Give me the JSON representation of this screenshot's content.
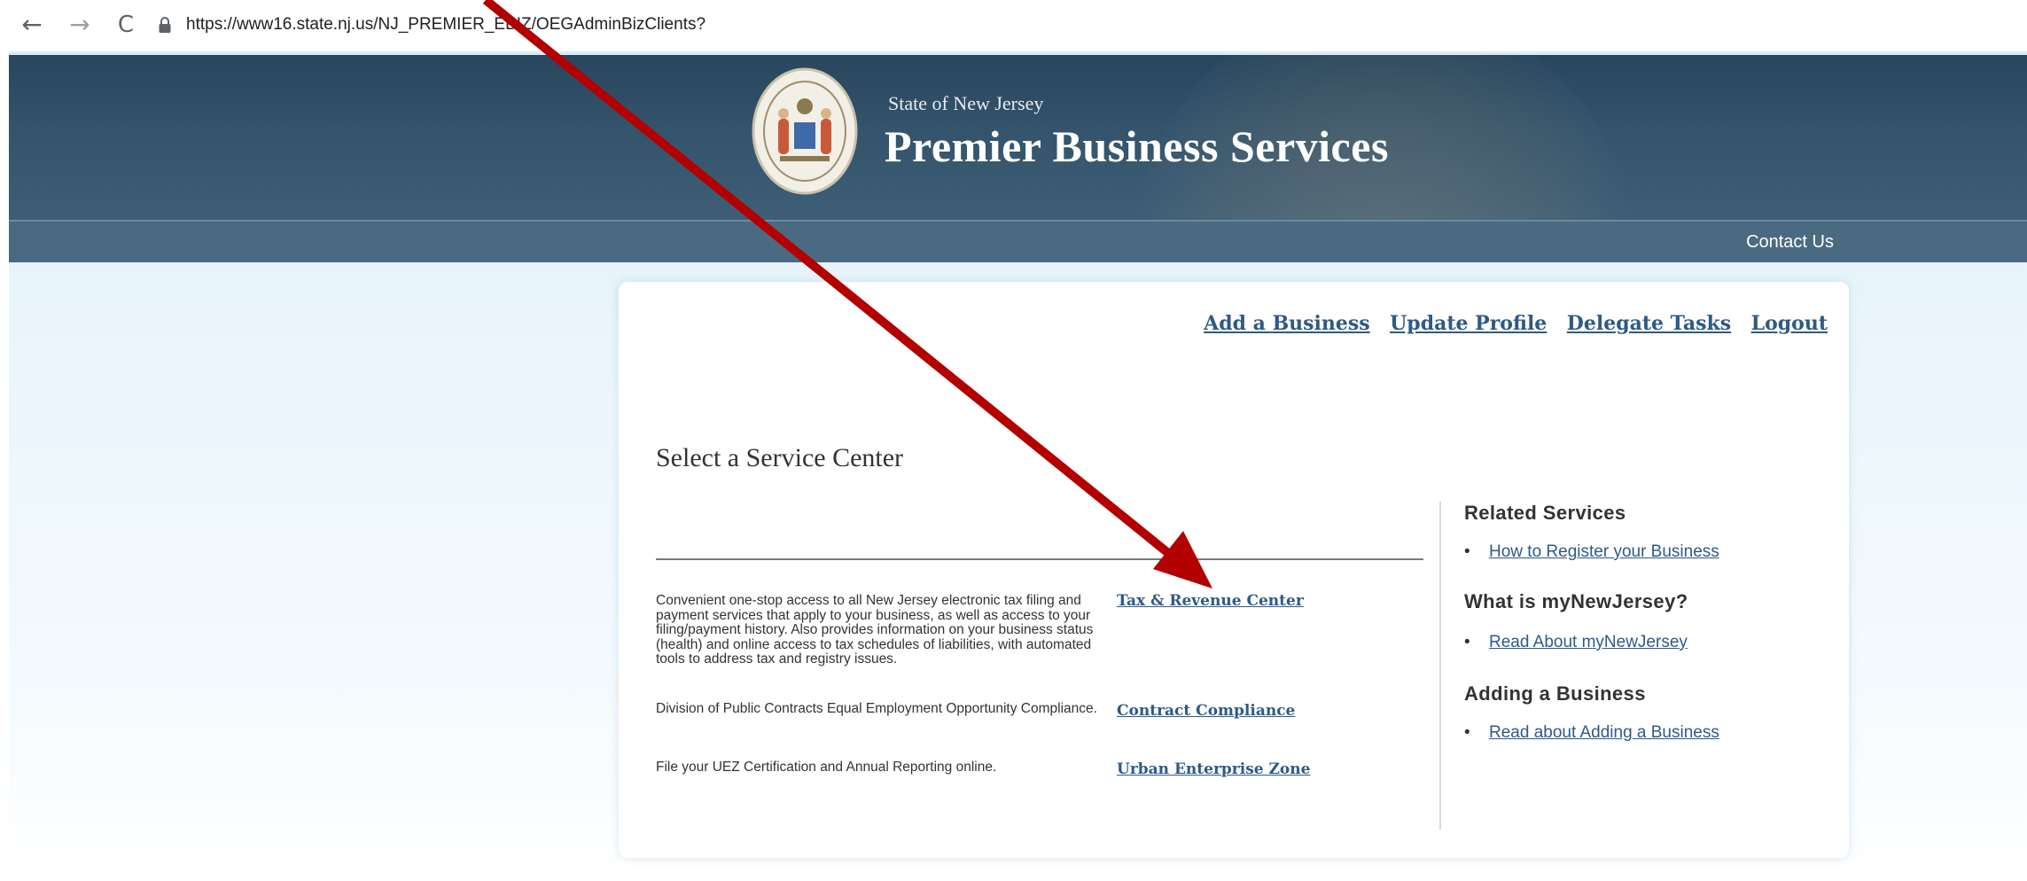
{
  "browser": {
    "url": "https://www16.state.nj.us/NJ_PREMIER_EBIZ/OEGAdminBizClients?",
    "back_glyph": "←",
    "forward_glyph": "→",
    "reload_glyph": "C"
  },
  "header": {
    "subtitle": "State of New Jersey",
    "title": "Premier Business Services"
  },
  "subnav": {
    "contact_label": "Contact Us"
  },
  "toplinks": [
    {
      "label": "Add a Business"
    },
    {
      "label": "Update Profile"
    },
    {
      "label": "Delegate Tasks"
    },
    {
      "label": "Logout"
    }
  ],
  "main": {
    "section_title": "Select a Service Center",
    "services": [
      {
        "description": "Convenient one-stop access to all New Jersey electronic tax filing and payment services that apply to your business, as well as access to your filing/payment history. Also provides information on your business status (health) and online access to tax schedules of liabilities, with automated tools to address tax and registry issues.",
        "link": "Tax & Revenue Center"
      },
      {
        "description": "Division of Public Contracts Equal Employment Opportunity Compliance.",
        "link": "Contract Compliance"
      },
      {
        "description": "File your UEZ Certification and Annual Reporting online.",
        "link": "Urban Enterprise Zone"
      }
    ]
  },
  "sidebar": {
    "sections": [
      {
        "heading": "Related Services",
        "link": "How to Register your Business"
      },
      {
        "heading": "What is myNewJersey?",
        "link": "Read About myNewJersey"
      },
      {
        "heading": "Adding a Business",
        "link": "Read about Adding a Business"
      }
    ],
    "bullet": "•"
  },
  "colors": {
    "header_bg": "#34546c",
    "subnav_bg": "#4a6a82",
    "link": "#2d5a87",
    "annotation_arrow": "#b30000"
  },
  "icons": {
    "lock": "lock-icon",
    "seal": "state-seal-icon",
    "arrow": "annotation-arrow"
  }
}
